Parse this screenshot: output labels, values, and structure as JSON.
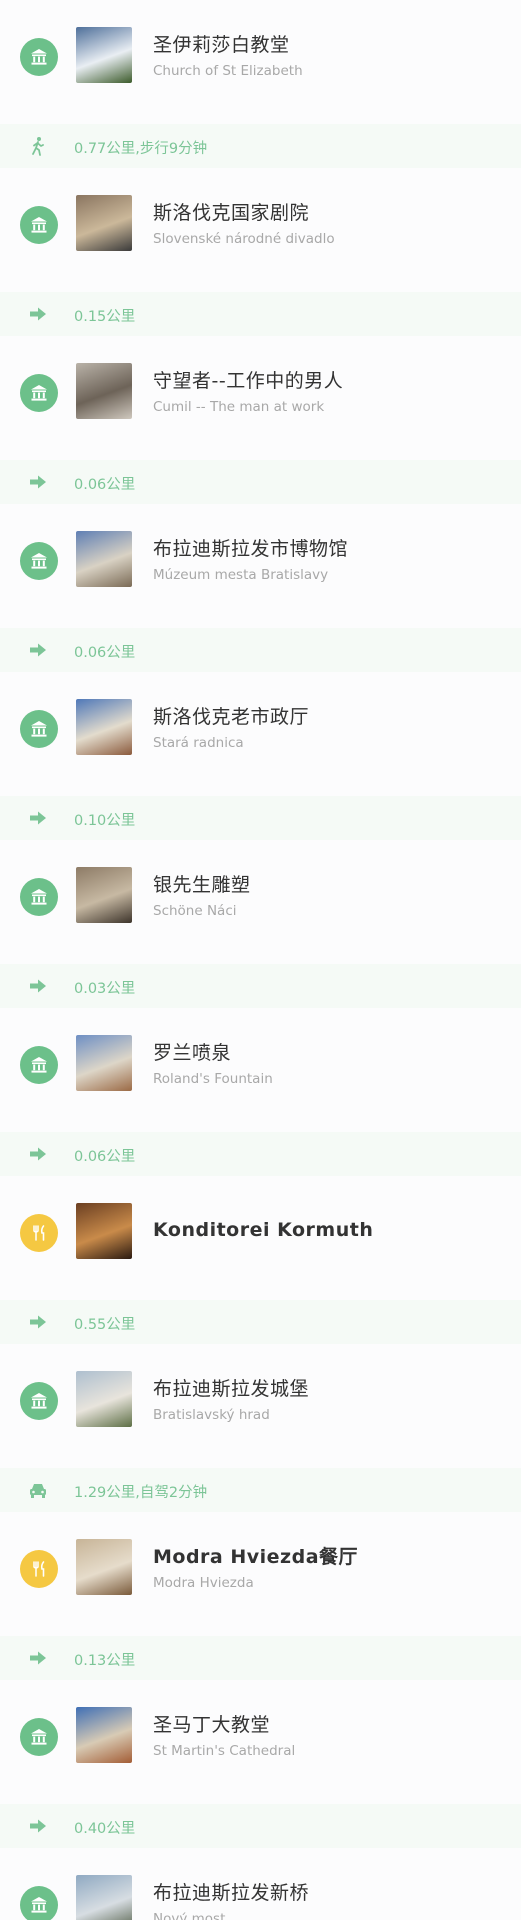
{
  "colors": {
    "sight_icon_bg": "#6cc08a",
    "food_icon_bg": "#f5c842",
    "leg_text": "#7cc597",
    "leg_bg": "#f5faf6"
  },
  "itinerary": [
    {
      "kind": "poi",
      "type": "sight",
      "icon": "museum-icon",
      "thumb_colors": [
        "#4e6f9a",
        "#e9eef3",
        "#3c5b2b"
      ],
      "name": "圣伊莉莎白教堂",
      "sub": "Church of St Elizabeth"
    },
    {
      "kind": "leg",
      "mode": "walk-icon",
      "text": "0.77公里,步行9分钟"
    },
    {
      "kind": "poi",
      "type": "sight",
      "icon": "museum-icon",
      "thumb_colors": [
        "#8a7560",
        "#cbb89a",
        "#3a3a3a"
      ],
      "name": "斯洛伐克国家剧院",
      "sub": "Slovenské národné divadlo"
    },
    {
      "kind": "leg",
      "mode": "arrow-icon",
      "text": "0.15公里"
    },
    {
      "kind": "poi",
      "type": "sight",
      "icon": "museum-icon",
      "thumb_colors": [
        "#b9b2a8",
        "#6d6358",
        "#cfc8be"
      ],
      "name": "守望者--工作中的男人",
      "sub": "Cumil -- The man at work"
    },
    {
      "kind": "leg",
      "mode": "arrow-icon",
      "text": "0.06公里"
    },
    {
      "kind": "poi",
      "type": "sight",
      "icon": "museum-icon",
      "thumb_colors": [
        "#5f7fb4",
        "#d9d2c4",
        "#7a6a55"
      ],
      "name": "布拉迪斯拉发市博物馆",
      "sub": "Múzeum mesta Bratislavy"
    },
    {
      "kind": "leg",
      "mode": "arrow-icon",
      "text": "0.06公里"
    },
    {
      "kind": "poi",
      "type": "sight",
      "icon": "museum-icon",
      "thumb_colors": [
        "#4f78b8",
        "#e3dccd",
        "#8b5a3c"
      ],
      "name": "斯洛伐克老市政厅",
      "sub": "Stará radnica"
    },
    {
      "kind": "leg",
      "mode": "arrow-icon",
      "text": "0.10公里"
    },
    {
      "kind": "poi",
      "type": "sight",
      "icon": "museum-icon",
      "thumb_colors": [
        "#8d7b66",
        "#c7b9a3",
        "#3d342b"
      ],
      "name": "银先生雕塑",
      "sub": "Schöne Náci"
    },
    {
      "kind": "leg",
      "mode": "arrow-icon",
      "text": "0.03公里"
    },
    {
      "kind": "poi",
      "type": "sight",
      "icon": "museum-icon",
      "thumb_colors": [
        "#6e8fc4",
        "#ddd6c8",
        "#9b6a45"
      ],
      "name": "罗兰喷泉",
      "sub": "Roland's Fountain"
    },
    {
      "kind": "leg",
      "mode": "arrow-icon",
      "text": "0.06公里"
    },
    {
      "kind": "poi",
      "type": "food",
      "icon": "cutlery-icon",
      "thumb_colors": [
        "#6b3f22",
        "#c98b4a",
        "#2b1a10"
      ],
      "name": "Konditorei Kormuth",
      "sub": ""
    },
    {
      "kind": "leg",
      "mode": "arrow-icon",
      "text": "0.55公里"
    },
    {
      "kind": "poi",
      "type": "sight",
      "icon": "museum-icon",
      "thumb_colors": [
        "#aebfcf",
        "#e8e4dc",
        "#5d6f45"
      ],
      "name": "布拉迪斯拉发城堡",
      "sub": "Bratislavský hrad"
    },
    {
      "kind": "leg",
      "mode": "car-icon",
      "text": "1.29公里,自驾2分钟"
    },
    {
      "kind": "poi",
      "type": "food",
      "icon": "cutlery-icon",
      "thumb_colors": [
        "#c7b497",
        "#e6dccb",
        "#7a5a3a"
      ],
      "name": "Modra Hviezda餐厅",
      "sub": "Modra Hviezda"
    },
    {
      "kind": "leg",
      "mode": "arrow-icon",
      "text": "0.13公里"
    },
    {
      "kind": "poi",
      "type": "sight",
      "icon": "museum-icon",
      "thumb_colors": [
        "#3f6fb5",
        "#d8cbb5",
        "#a35d35"
      ],
      "name": "圣马丁大教堂",
      "sub": "St Martin's Cathedral"
    },
    {
      "kind": "leg",
      "mode": "arrow-icon",
      "text": "0.40公里"
    },
    {
      "kind": "poi",
      "type": "sight",
      "icon": "museum-icon",
      "thumb_colors": [
        "#8fa9c2",
        "#d7dde2",
        "#4f5b44"
      ],
      "name": "布拉迪斯拉发新桥",
      "sub": "Nový most"
    }
  ]
}
